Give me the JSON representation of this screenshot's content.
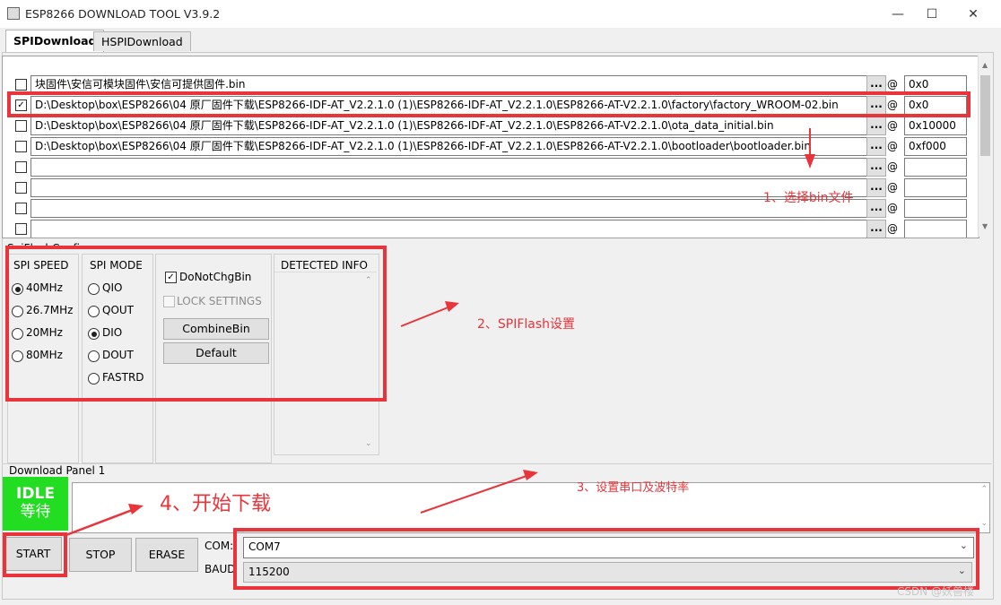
{
  "window": {
    "title": "ESP8266 DOWNLOAD TOOL V3.9.2",
    "minimize": "—",
    "maximize": "☐",
    "close": "✕"
  },
  "tabs": [
    {
      "label": "SPIDownload",
      "active": true
    },
    {
      "label": "HSPIDownload",
      "active": false
    }
  ],
  "files": [
    {
      "checked": false,
      "check_mark": "",
      "path": "块固件\\安信可模块固件\\安信可提供固件.bin",
      "browse": "...",
      "at": "@",
      "addr": "0x0"
    },
    {
      "checked": true,
      "check_mark": "✓",
      "path": "D:\\Desktop\\box\\ESP8266\\04 原厂固件下载\\ESP8266-IDF-AT_V2.2.1.0 (1)\\ESP8266-IDF-AT_V2.2.1.0\\ESP8266-AT-V2.2.1.0\\factory\\factory_WROOM-02.bin",
      "browse": "...",
      "at": "@",
      "addr": "0x0"
    },
    {
      "checked": false,
      "check_mark": "",
      "path": "D:\\Desktop\\box\\ESP8266\\04 原厂固件下载\\ESP8266-IDF-AT_V2.2.1.0 (1)\\ESP8266-IDF-AT_V2.2.1.0\\ESP8266-AT-V2.2.1.0\\ota_data_initial.bin",
      "browse": "...",
      "at": "@",
      "addr": "0x10000"
    },
    {
      "checked": false,
      "check_mark": "",
      "path": "D:\\Desktop\\box\\ESP8266\\04 原厂固件下载\\ESP8266-IDF-AT_V2.2.1.0 (1)\\ESP8266-IDF-AT_V2.2.1.0\\ESP8266-AT-V2.2.1.0\\bootloader\\bootloader.bin",
      "browse": "...",
      "at": "@",
      "addr": "0xf000"
    },
    {
      "checked": false,
      "check_mark": "",
      "path": "",
      "browse": "...",
      "at": "@",
      "addr": ""
    },
    {
      "checked": false,
      "check_mark": "",
      "path": "",
      "browse": "...",
      "at": "@",
      "addr": ""
    },
    {
      "checked": false,
      "check_mark": "",
      "path": "",
      "browse": "...",
      "at": "@",
      "addr": ""
    },
    {
      "checked": false,
      "check_mark": "",
      "path": "",
      "browse": "...",
      "at": "@",
      "addr": ""
    }
  ],
  "spi_config": {
    "group_label": "SpiFlashConfig",
    "speed": {
      "label": "SPI SPEED",
      "options": [
        "40MHz",
        "26.7MHz",
        "20MHz",
        "80MHz"
      ],
      "selected": "40MHz"
    },
    "mode": {
      "label": "SPI MODE",
      "options": [
        "QIO",
        "QOUT",
        "DIO",
        "DOUT",
        "FASTRD"
      ],
      "selected": "DIO"
    },
    "do_not_chg_bin": "DoNotChgBin",
    "lock_settings": "LOCK SETTINGS",
    "combine_bin": "CombineBin",
    "default": "Default",
    "detected_info": "DETECTED INFO"
  },
  "download_panel": {
    "label": "Download Panel 1",
    "status_en": "IDLE",
    "status_cn": "等待",
    "status_color": "#22dd22",
    "start": "START",
    "stop": "STOP",
    "erase": "ERASE",
    "com_label": "COM:",
    "com_value": "COM7",
    "baud_label": "BAUD",
    "baud_value": "115200"
  },
  "annotations": {
    "step1": "1、选择bin文件",
    "step2": "2、SPIFlash设置",
    "step3": "3、设置串口及波特率",
    "step4": "4、开始下载",
    "color": "#e8343a"
  },
  "watermark": "CSDN @妖兽楼"
}
